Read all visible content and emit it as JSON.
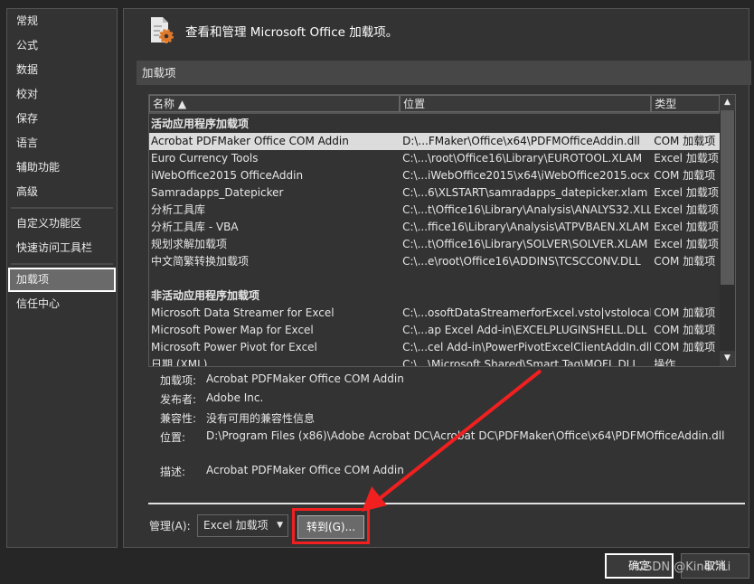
{
  "sidebar": {
    "items": [
      {
        "label": "常规"
      },
      {
        "label": "公式"
      },
      {
        "label": "数据"
      },
      {
        "label": "校对"
      },
      {
        "label": "保存"
      },
      {
        "label": "语言"
      },
      {
        "label": "辅助功能"
      },
      {
        "label": "高级"
      },
      {
        "label": "自定义功能区"
      },
      {
        "label": "快速访问工具栏"
      },
      {
        "label": "加载项",
        "selected": true
      },
      {
        "label": "信任中心"
      }
    ]
  },
  "header": {
    "title": "查看和管理 Microsoft Office 加载项。",
    "icon": "addins-gear-icon",
    "icon_color": "#e07a2a"
  },
  "section": {
    "title": "加载项"
  },
  "table": {
    "columns": [
      "名称 ▲",
      "位置",
      "类型"
    ],
    "groups": [
      {
        "title": "活动应用程序加载项",
        "rows": [
          [
            "Acrobat PDFMaker Office COM Addin",
            "D:\\...FMaker\\Office\\x64\\PDFMOfficeAddin.dll",
            "COM 加载项"
          ],
          [
            "Euro Currency Tools",
            "C:\\...\\root\\Office16\\Library\\EUROTOOL.XLAM",
            "Excel 加载项"
          ],
          [
            "iWebOffice2015 OfficeAddin",
            "C:\\...iWebOffice2015\\x64\\iWebOffice2015.ocx",
            "COM 加载项"
          ],
          [
            "Samradapps_Datepicker",
            "C:\\...6\\XLSTART\\samradapps_datepicker.xlam",
            "Excel 加载项"
          ],
          [
            "分析工具库",
            "C:\\...t\\Office16\\Library\\Analysis\\ANALYS32.XLL",
            "Excel 加载项"
          ],
          [
            "分析工具库 - VBA",
            "C:\\...ffice16\\Library\\Analysis\\ATPVBAEN.XLAM",
            "Excel 加载项"
          ],
          [
            "规划求解加载项",
            "C:\\...t\\Office16\\Library\\SOLVER\\SOLVER.XLAM",
            "Excel 加载项"
          ],
          [
            "中文简繁转换加载项",
            "C:\\...e\\root\\Office16\\ADDINS\\TCSCCONV.DLL",
            "COM 加载项"
          ]
        ]
      },
      {
        "title": "非活动应用程序加载项",
        "rows": [
          [
            "Microsoft Data Streamer for Excel",
            "C:\\...osoftDataStreamerforExcel.vsto|vstolocal",
            "COM 加载项"
          ],
          [
            "Microsoft Power Map for Excel",
            "C:\\...ap Excel Add-in\\EXCELPLUGINSHELL.DLL",
            "COM 加载项"
          ],
          [
            "Microsoft Power Pivot for Excel",
            "C:\\...cel Add-in\\PowerPivotExcelClientAddIn.dll",
            "COM 加载项"
          ],
          [
            "日期 (XML)",
            "C:\\...\\Microsoft Shared\\Smart Tag\\MOFL.DLL",
            "操作"
          ]
        ]
      }
    ],
    "selected_row": 0
  },
  "details": {
    "addin_label": "加载项:",
    "addin": "Acrobat PDFMaker Office COM Addin",
    "publisher_label": "发布者:",
    "publisher": "Adobe Inc.",
    "compat_label": "兼容性:",
    "compat": "没有可用的兼容性信息",
    "location_label": "位置:",
    "location": "D:\\Program Files (x86)\\Adobe Acrobat DC\\Acrobat DC\\PDFMaker\\Office\\x64\\PDFMOfficeAddin.dll",
    "desc_label": "描述:",
    "desc": "Acrobat PDFMaker Office COM Addin"
  },
  "manage": {
    "label": "管理(A):",
    "value": "Excel 加载项",
    "goto": "转到(G)..."
  },
  "footer": {
    "ok": "确定",
    "cancel": "取消"
  },
  "annotation_color": "#f02020",
  "watermark": "CSDN @Kino^Li"
}
